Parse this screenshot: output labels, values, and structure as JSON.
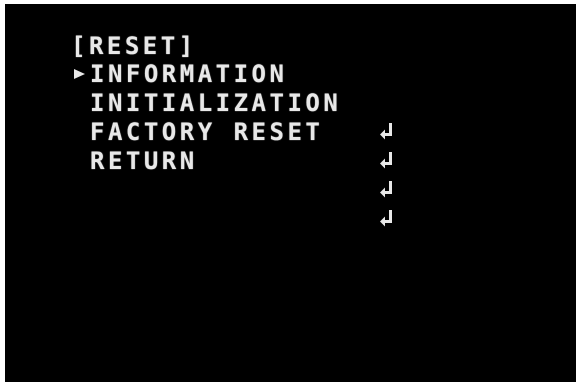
{
  "menu": {
    "title": "[RESET]",
    "selected_index": 0,
    "items": [
      {
        "label": "INFORMATION",
        "icon": "enter-icon"
      },
      {
        "label": "INITIALIZATION",
        "icon": "enter-icon"
      },
      {
        "label": "FACTORY RESET",
        "icon": "enter-icon"
      },
      {
        "label": "RETURN",
        "icon": "enter-icon"
      }
    ]
  },
  "colors": {
    "background": "#000000",
    "text": "#e8e8e8"
  }
}
